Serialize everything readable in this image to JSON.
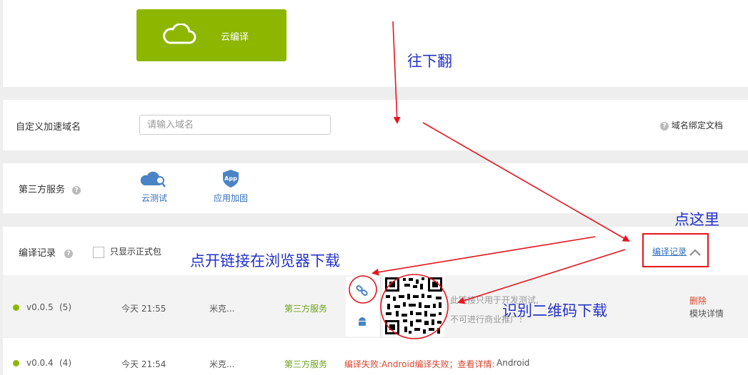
{
  "top": {
    "cloud_button_label": "云编译"
  },
  "domain": {
    "label": "自定义加速域名",
    "placeholder": "请输入域名",
    "doc_link": "域名绑定文档"
  },
  "third_party": {
    "label": "第三方服务",
    "services": [
      {
        "label": "云测试",
        "icon": "cloud-search-icon"
      },
      {
        "label": "应用加固",
        "icon": "app-shield-icon"
      }
    ]
  },
  "records": {
    "label": "编译记录",
    "checkbox_label": "只显示正式包",
    "toggle_label": "编译记录",
    "rows": [
      {
        "version": "v0.0.5",
        "count": "(5)",
        "time": "今天 21:55",
        "user": "米克...",
        "service": "第三方服务",
        "notice_line1": "此链接只用于开发测试,",
        "notice_line2": "不可进行商业推广！",
        "delete_label": "删除",
        "details_label": "模块详情"
      },
      {
        "version": "v0.0.4",
        "count": "(4)",
        "time": "今天 21:54",
        "user": "米克...",
        "service": "第三方服务",
        "error": "编译失败:Android编译失败；查看详情:",
        "error_link": "Android"
      }
    ]
  },
  "annotations": {
    "scroll_down": "往下翻",
    "click_here": "点这里",
    "open_link": "点开链接在浏览器下载",
    "scan_qr": "识别二维码下载"
  },
  "colors": {
    "accent_green": "#8db600",
    "link_blue": "#2f6ebb",
    "annotation_red": "#e8141c",
    "annotation_blue": "#2432c8"
  }
}
